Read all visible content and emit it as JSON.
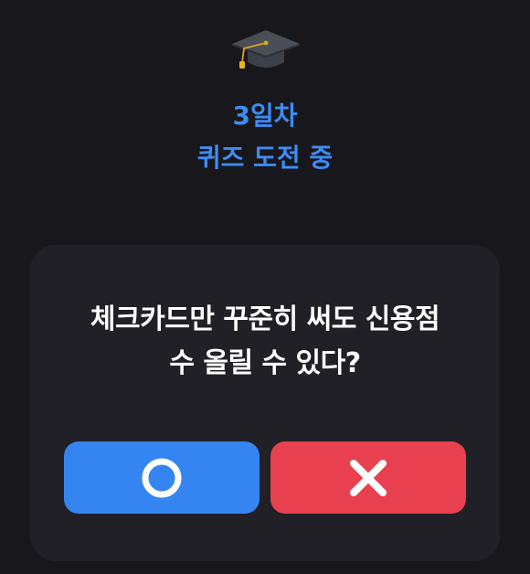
{
  "header": {
    "icon": "graduation-cap-icon",
    "day_label": "3일차",
    "status_label": "퀴즈 도전 중"
  },
  "quiz": {
    "question_line1": "체크카드만 꾸준히 써도 신용점",
    "question_line2": "수 올릴 수 있다?",
    "answers": [
      {
        "name": "o-button",
        "icon": "circle-icon",
        "color": "#3485f2"
      },
      {
        "name": "x-button",
        "icon": "x-icon",
        "color": "#e9404f"
      }
    ]
  },
  "colors": {
    "background": "#17171c",
    "card": "#202026",
    "accent": "#3d8cf5",
    "true": "#3485f2",
    "false": "#e9404f"
  }
}
